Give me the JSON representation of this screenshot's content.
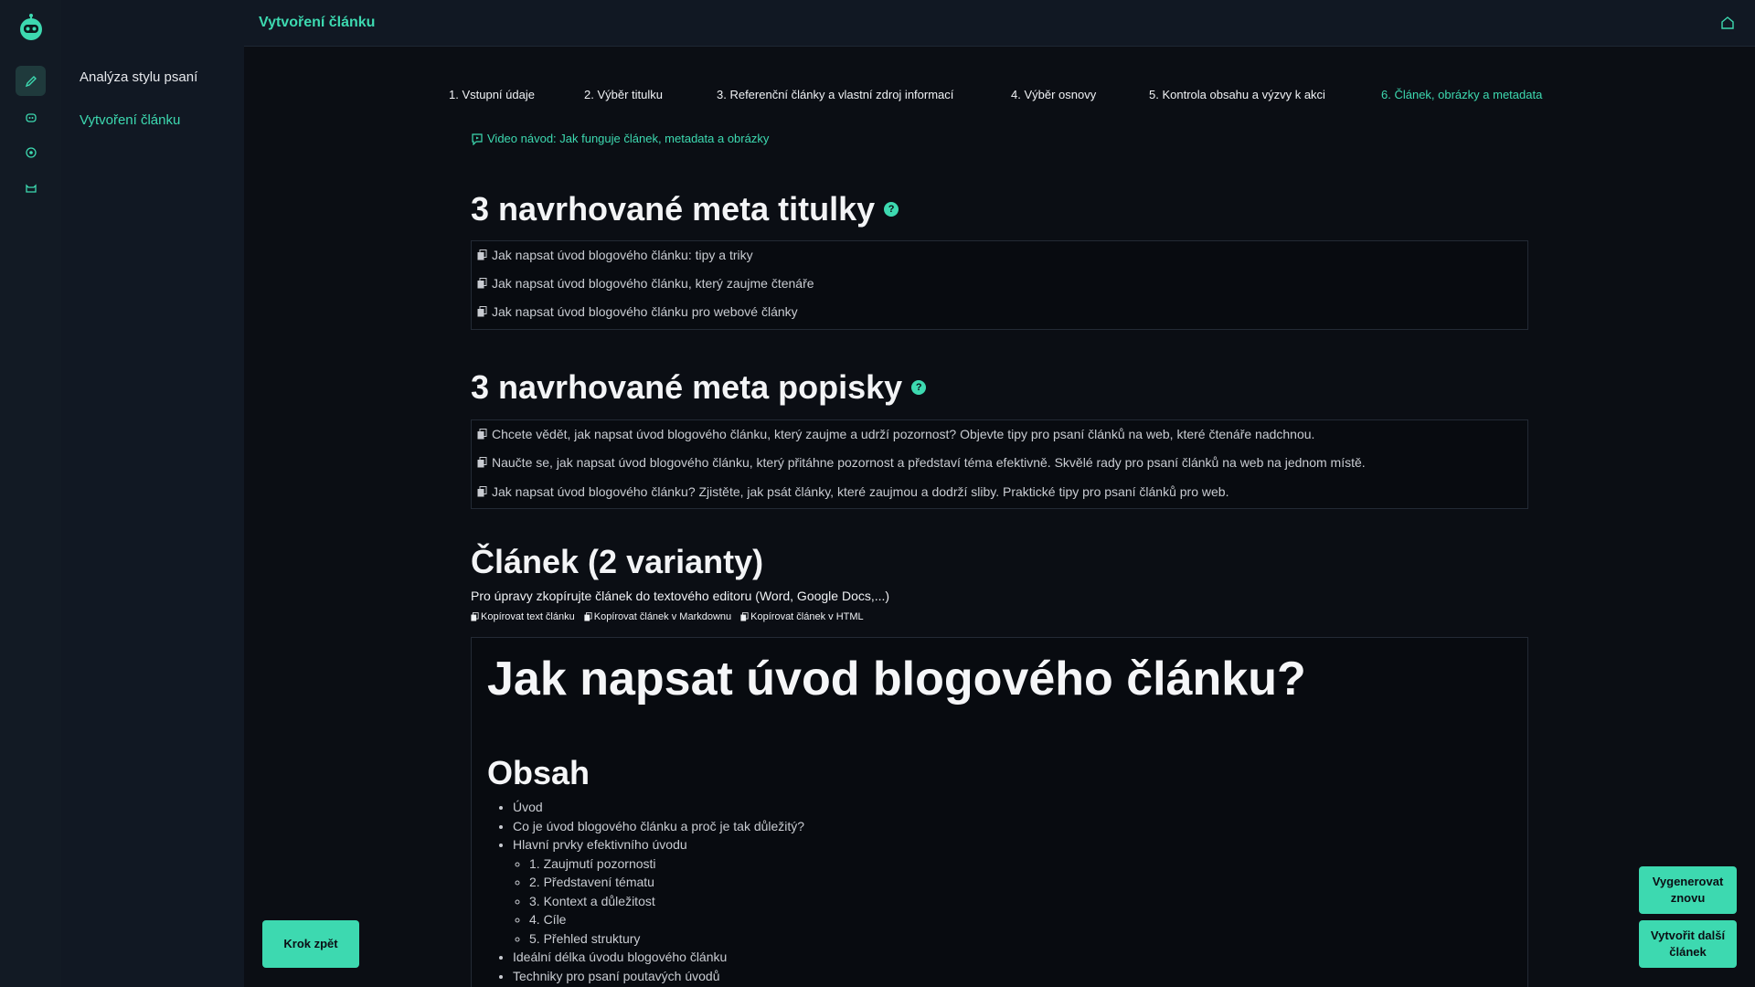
{
  "header": {
    "title": "Vytvoření článku"
  },
  "sidebar": {
    "items": [
      {
        "label": "Analýza stylu psaní"
      },
      {
        "label": "Vytvoření článku"
      }
    ]
  },
  "steps": [
    {
      "label": "1. Vstupní údaje"
    },
    {
      "label": "2. Výběr titulku"
    },
    {
      "label": "3. Referenční články a vlastní zdroj informací"
    },
    {
      "label": "4. Výběr osnovy"
    },
    {
      "label": "5. Kontrola obsahu a výzvy k akci"
    },
    {
      "label": "6. Článek, obrázky a metadata"
    }
  ],
  "video_link": "Video návod: Jak funguje článek, metadata a obrázky",
  "meta_titles": {
    "heading": "3 navrhované meta titulky",
    "items": [
      "Jak napsat úvod blogového článku: tipy a triky",
      "Jak napsat úvod blogového článku, který zaujme čtenáře",
      "Jak napsat úvod blogového článku pro webové články"
    ]
  },
  "meta_descriptions": {
    "heading": "3 navrhované meta popisky",
    "items": [
      "Chcete vědět, jak napsat úvod blogového článku, který zaujme a udrží pozornost? Objevte tipy pro psaní článků na web, které čtenáře nadchnou.",
      "Naučte se, jak napsat úvod blogového článku, který přitáhne pozornost a představí téma efektivně. Skvělé rady pro psaní článků na web na jednom místě.",
      "Jak napsat úvod blogového článku? Zjistěte, jak psát články, které zaujmou a dodrží sliby. Praktické tipy pro psaní článků pro web."
    ]
  },
  "article": {
    "heading": "Článek (2 varianty)",
    "subtitle": "Pro úpravy zkopírujte článek do textového editoru (Word, Google Docs,...)",
    "copy_actions": [
      "Kopírovat text článku",
      "Kopírovat článek v Markdownu",
      "Kopírovat článek v HTML"
    ],
    "title": "Jak napsat úvod blogového článku?",
    "toc_heading": "Obsah",
    "toc": {
      "i1": "Úvod",
      "i2": "Co je úvod blogového článku a proč je tak důležitý?",
      "i3": "Hlavní prvky efektivního úvodu",
      "sub": [
        "1. Zaujmutí pozornosti",
        "2. Představení tématu",
        "3. Kontext a důležitost",
        "4. Cíle",
        "5. Přehled struktury"
      ],
      "i4": "Ideální délka úvodu blogového článku",
      "i5": "Techniky pro psaní poutavých úvodů"
    }
  },
  "buttons": {
    "back": "Krok zpět",
    "regenerate": "Vygenerovat znovu",
    "next_article": "Vytvořit další článek"
  },
  "colors": {
    "accent": "#3dd9b0",
    "background": "#0b0e14",
    "sidebar": "#111823"
  },
  "icons": [
    "robot-logo-icon",
    "pencil-icon",
    "robot-icon",
    "target-icon",
    "cat-icon",
    "home-icon",
    "video-icon",
    "copy-icon",
    "help-icon"
  ]
}
